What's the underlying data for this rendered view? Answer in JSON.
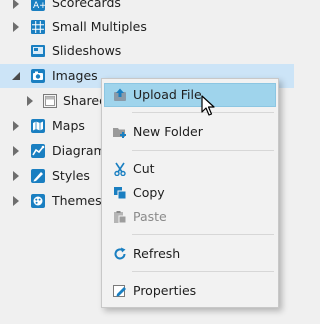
{
  "tree": {
    "items": [
      {
        "label": "Scorecards",
        "icon": "scorecard-icon"
      },
      {
        "label": "Small Multiples",
        "icon": "grid-icon"
      },
      {
        "label": "Slideshows",
        "icon": "slideshow-icon"
      },
      {
        "label": "Images",
        "icon": "camera-icon"
      },
      {
        "label": "Shared",
        "icon": "folder-icon"
      },
      {
        "label": "Maps",
        "icon": "map-icon"
      },
      {
        "label": "Diagrams",
        "icon": "diagram-icon"
      },
      {
        "label": "Styles",
        "icon": "styles-icon"
      },
      {
        "label": "Themes",
        "icon": "themes-icon"
      }
    ]
  },
  "context_menu": {
    "upload_file": "Upload File",
    "new_folder": "New Folder",
    "cut": "Cut",
    "copy": "Copy",
    "paste": "Paste",
    "refresh": "Refresh",
    "properties": "Properties"
  },
  "colors": {
    "selection": "#cce4f7",
    "hover": "#9fd4ec",
    "accent": "#1a7fc1"
  }
}
